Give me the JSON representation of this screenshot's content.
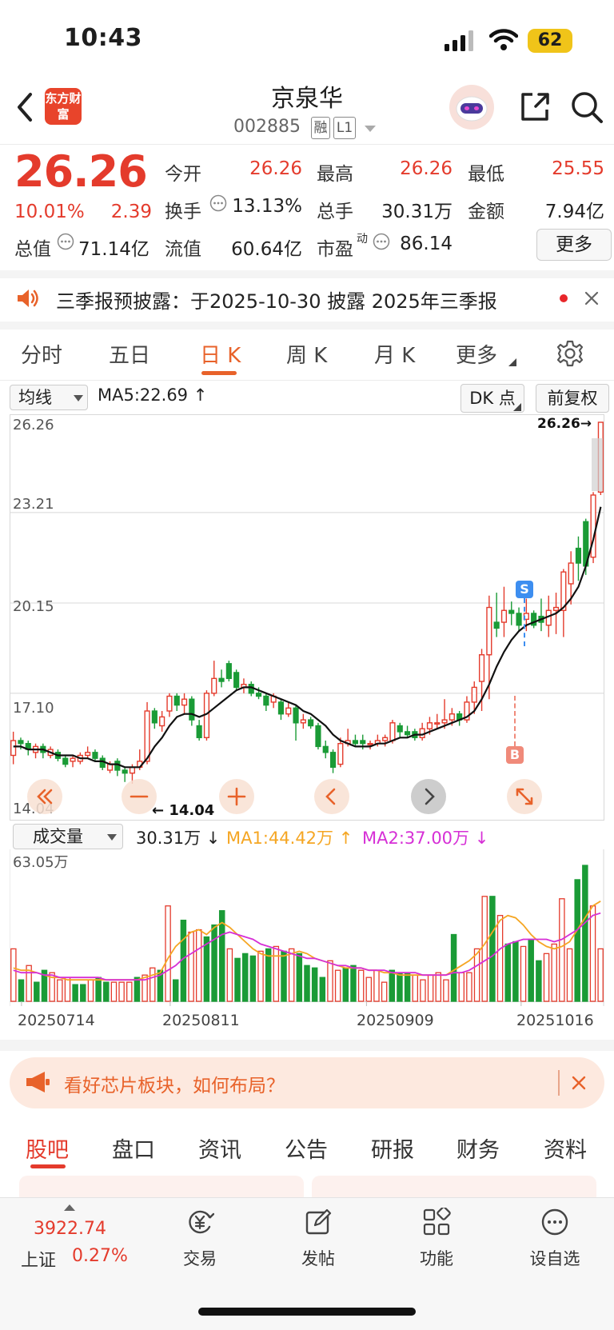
{
  "status_bar": {
    "time": "10:43",
    "battery": "62"
  },
  "header": {
    "title": "京泉华",
    "code": "002885",
    "tags": [
      "融",
      "L1"
    ],
    "logo_text": "东方财富"
  },
  "quote": {
    "price": "26.26",
    "change_pct": "10.01%",
    "change": "2.39",
    "total_value_label": "总值",
    "total_value": "71.14亿",
    "open_label": "今开",
    "open": "26.26",
    "high_label": "最高",
    "high": "26.26",
    "low_label": "最低",
    "low": "25.55",
    "turnover_label": "换手",
    "turnover": "13.13%",
    "volume_label": "总手",
    "volume": "30.31万",
    "amount_label": "金额",
    "amount": "7.94亿",
    "float_label": "流值",
    "float_value": "60.64亿",
    "pe_label": "市盈",
    "pe_sup": "动",
    "pe": "86.14",
    "more_label": "更多"
  },
  "notice": {
    "text": "三季报预披露：于2025-10-30 披露 2025年三季报"
  },
  "period_tabs": [
    "分时",
    "五日",
    "日 K",
    "周 K",
    "月 K",
    "更多"
  ],
  "active_period": "日 K",
  "chart_toolbar": {
    "ma_select": "均线",
    "ma5": "MA5:22.69",
    "dk_label": "DK 点",
    "adjust_label": "前复权"
  },
  "kline": {
    "y_labels": [
      "26.26",
      "23.21",
      "20.15",
      "17.10",
      "14.04"
    ],
    "last_price_tag": "26.26→",
    "min_tag": "14.04",
    "signals": {
      "sell": "S",
      "buy": "B"
    }
  },
  "volume_toolbar": {
    "select": "成交量",
    "value": "30.31万",
    "ma1": "MA1:44.42万",
    "ma2": "MA2:37.00万",
    "y_label": "63.05万"
  },
  "x_labels": [
    "20250714",
    "20250811",
    "20250909",
    "20251016"
  ],
  "chart_data": {
    "type": "candlestick",
    "title": "",
    "ylim": [
      14.04,
      26.26
    ],
    "colors": {
      "up": "#e43b2c",
      "down": "#1a9b36",
      "ma_price": "#111111",
      "ma1": "#f5a623",
      "ma2": "#d62fd6"
    },
    "candles": [
      [
        15.0,
        15.5,
        15.8,
        14.7
      ],
      [
        15.5,
        15.4,
        15.6,
        15.2
      ],
      [
        15.4,
        15.2,
        15.5,
        15.0
      ],
      [
        15.1,
        15.3,
        15.4,
        14.9
      ],
      [
        15.3,
        15.1,
        15.4,
        14.9
      ],
      [
        15.0,
        15.2,
        15.3,
        14.9
      ],
      [
        15.1,
        14.9,
        15.2,
        14.8
      ],
      [
        14.9,
        14.7,
        15.0,
        14.6
      ],
      [
        14.8,
        14.9,
        15.0,
        14.6
      ],
      [
        14.8,
        15.0,
        15.1,
        14.7
      ],
      [
        15.0,
        15.1,
        15.3,
        14.9
      ],
      [
        15.1,
        14.9,
        15.2,
        14.8
      ],
      [
        14.9,
        14.6,
        15.0,
        14.5
      ],
      [
        14.5,
        14.7,
        14.8,
        14.4
      ],
      [
        14.8,
        14.5,
        14.9,
        14.3
      ],
      [
        14.5,
        14.4,
        14.6,
        14.1
      ],
      [
        14.4,
        14.6,
        14.7,
        14.04
      ],
      [
        14.6,
        14.8,
        15.2,
        14.5
      ],
      [
        14.8,
        16.5,
        16.8,
        14.7
      ],
      [
        16.5,
        16.1,
        16.6,
        15.9
      ],
      [
        16.0,
        16.3,
        16.5,
        15.8
      ],
      [
        16.5,
        17.0,
        17.1,
        16.3
      ],
      [
        17.0,
        16.7,
        17.1,
        16.5
      ],
      [
        16.7,
        16.9,
        17.1,
        16.4
      ],
      [
        16.9,
        16.2,
        17.0,
        16.0
      ],
      [
        16.0,
        15.6,
        16.2,
        15.5
      ],
      [
        15.6,
        17.1,
        17.2,
        15.5
      ],
      [
        17.1,
        17.6,
        18.2,
        17.0
      ],
      [
        17.6,
        17.5,
        17.9,
        17.3
      ],
      [
        18.1,
        17.6,
        18.2,
        17.5
      ],
      [
        17.8,
        17.3,
        17.9,
        17.2
      ],
      [
        17.3,
        17.4,
        17.6,
        17.1
      ],
      [
        17.4,
        17.1,
        17.5,
        17.0
      ],
      [
        17.1,
        17.0,
        17.3,
        16.9
      ],
      [
        17.0,
        16.7,
        17.1,
        16.5
      ],
      [
        16.8,
        17.0,
        17.1,
        16.6
      ],
      [
        16.8,
        16.4,
        16.9,
        16.2
      ],
      [
        16.4,
        16.6,
        16.8,
        16.3
      ],
      [
        16.6,
        16.1,
        16.7,
        15.5
      ],
      [
        16.1,
        16.2,
        16.4,
        15.9
      ],
      [
        16.2,
        16.0,
        16.3,
        15.9
      ],
      [
        16.0,
        15.3,
        16.1,
        15.2
      ],
      [
        15.3,
        15.1,
        15.5,
        14.9
      ],
      [
        15.1,
        14.6,
        15.2,
        14.4
      ],
      [
        14.7,
        15.4,
        15.6,
        14.6
      ],
      [
        15.4,
        15.5,
        15.9,
        15.3
      ],
      [
        15.5,
        15.4,
        15.7,
        15.3
      ],
      [
        15.5,
        15.4,
        15.7,
        15.2
      ],
      [
        15.4,
        15.4,
        15.5,
        15.2
      ],
      [
        15.4,
        15.5,
        15.7,
        15.3
      ],
      [
        15.5,
        15.6,
        15.7,
        15.3
      ],
      [
        15.5,
        16.1,
        16.2,
        15.4
      ],
      [
        16.0,
        15.8,
        16.1,
        15.6
      ],
      [
        15.8,
        15.7,
        16.0,
        15.6
      ],
      [
        15.8,
        15.6,
        15.9,
        15.5
      ],
      [
        15.6,
        15.9,
        16.1,
        15.5
      ],
      [
        15.9,
        16.1,
        16.3,
        15.7
      ],
      [
        16.1,
        16.1,
        16.4,
        15.9
      ],
      [
        16.1,
        16.2,
        16.9,
        15.9
      ],
      [
        16.2,
        16.4,
        16.6,
        16.0
      ],
      [
        16.4,
        16.2,
        16.5,
        16.0
      ],
      [
        16.2,
        16.8,
        17.0,
        16.1
      ],
      [
        16.8,
        17.3,
        17.5,
        16.4
      ],
      [
        17.5,
        18.4,
        18.6,
        16.5
      ],
      [
        18.4,
        20.0,
        20.4,
        16.9
      ],
      [
        19.5,
        19.3,
        20.5,
        19.0
      ],
      [
        19.5,
        19.9,
        20.7,
        19.0
      ],
      [
        19.9,
        19.8,
        20.2,
        19.4
      ],
      [
        19.8,
        19.4,
        20.0,
        19.2
      ],
      [
        19.6,
        19.8,
        20.3,
        19.2
      ],
      [
        19.8,
        19.4,
        19.9,
        19.3
      ],
      [
        19.7,
        19.5,
        20.3,
        19.2
      ],
      [
        19.4,
        19.9,
        20.4,
        19.0
      ],
      [
        19.9,
        20.0,
        20.5,
        19.1
      ],
      [
        19.9,
        21.2,
        21.3,
        19.0
      ],
      [
        20.8,
        21.5,
        21.9,
        20.1
      ],
      [
        22.0,
        21.5,
        22.4,
        20.9
      ],
      [
        22.9,
        21.4,
        23.0,
        21.1
      ],
      [
        21.7,
        23.8,
        23.9,
        21.5
      ],
      [
        23.9,
        26.26,
        26.26,
        23.8
      ]
    ],
    "ma_line": [
      15.3,
      15.3,
      15.2,
      15.2,
      15.2,
      15.1,
      15.0,
      15.0,
      15.0,
      14.9,
      14.9,
      14.8,
      14.8,
      14.7,
      14.7,
      14.6,
      14.6,
      14.6,
      14.9,
      15.3,
      15.6,
      16.0,
      16.3,
      16.4,
      16.4,
      16.3,
      16.4,
      16.6,
      16.8,
      17.0,
      17.2,
      17.3,
      17.3,
      17.2,
      17.1,
      17.0,
      16.9,
      16.8,
      16.7,
      16.5,
      16.4,
      16.2,
      16.0,
      15.7,
      15.5,
      15.4,
      15.3,
      15.3,
      15.3,
      15.4,
      15.4,
      15.5,
      15.6,
      15.6,
      15.7,
      15.7,
      15.8,
      15.9,
      16.0,
      16.1,
      16.2,
      16.3,
      16.5,
      16.9,
      17.4,
      18.0,
      18.5,
      18.9,
      19.2,
      19.4,
      19.5,
      19.6,
      19.7,
      19.8,
      20.0,
      20.3,
      20.7,
      21.4,
      22.3,
      23.4
    ],
    "volume_ylim": [
      0,
      63.05
    ],
    "volumes": [
      22,
      9,
      15,
      8,
      13,
      12,
      9,
      10,
      7,
      7,
      9,
      10,
      8,
      8,
      8,
      8,
      10,
      11,
      14,
      13,
      40,
      9,
      34,
      29,
      30,
      27,
      32,
      38,
      22,
      18,
      20,
      19,
      21,
      22,
      23,
      21,
      22,
      20,
      15,
      14,
      10,
      17,
      13,
      14,
      15,
      13,
      10,
      13,
      8,
      13,
      12,
      12,
      11,
      9,
      11,
      12,
      9,
      28,
      12,
      12,
      22,
      44,
      44,
      36,
      24,
      25,
      23,
      26,
      17,
      20,
      24,
      43,
      22,
      51,
      57,
      40,
      22
    ],
    "ma1": [
      14,
      13,
      13,
      12,
      11,
      10,
      10,
      9,
      9,
      9,
      9,
      9,
      9,
      9,
      9,
      9,
      9,
      10,
      11,
      12,
      18,
      23,
      26,
      29,
      30,
      28,
      31,
      33,
      31,
      28,
      25,
      22,
      20,
      19,
      19,
      19,
      20,
      21,
      20,
      18,
      17,
      16,
      15,
      14,
      14,
      14,
      13,
      13,
      12,
      12,
      11,
      11,
      11,
      11,
      11,
      11,
      11,
      13,
      15,
      17,
      20,
      24,
      29,
      34,
      36,
      35,
      32,
      28,
      25,
      23,
      22,
      23,
      25,
      30,
      35,
      40,
      42
    ],
    "ma2": [
      13,
      12,
      12,
      12,
      11,
      11,
      10,
      10,
      10,
      10,
      10,
      10,
      9,
      9,
      9,
      9,
      9,
      9,
      10,
      11,
      13,
      15,
      18,
      20,
      22,
      24,
      26,
      28,
      29,
      28,
      27,
      26,
      24,
      23,
      22,
      21,
      20,
      19,
      18,
      18,
      17,
      16,
      15,
      15,
      14,
      14,
      13,
      13,
      13,
      12,
      12,
      12,
      12,
      11,
      11,
      11,
      11,
      12,
      12,
      13,
      15,
      17,
      19,
      22,
      24,
      25,
      26,
      26,
      26,
      26,
      25,
      26,
      28,
      30,
      33,
      36,
      37
    ]
  },
  "promo": {
    "text": "看好芯片板块，如何布局？"
  },
  "bottom_tabs": [
    "股吧",
    "盘口",
    "资讯",
    "公告",
    "研报",
    "财务",
    "资料"
  ],
  "bottom_nav": {
    "index_value": "3922.74",
    "index_name": "上证",
    "index_change": "0.27%",
    "trade": "交易",
    "post": "发帖",
    "features": "功能",
    "watchlist": "设自选"
  }
}
